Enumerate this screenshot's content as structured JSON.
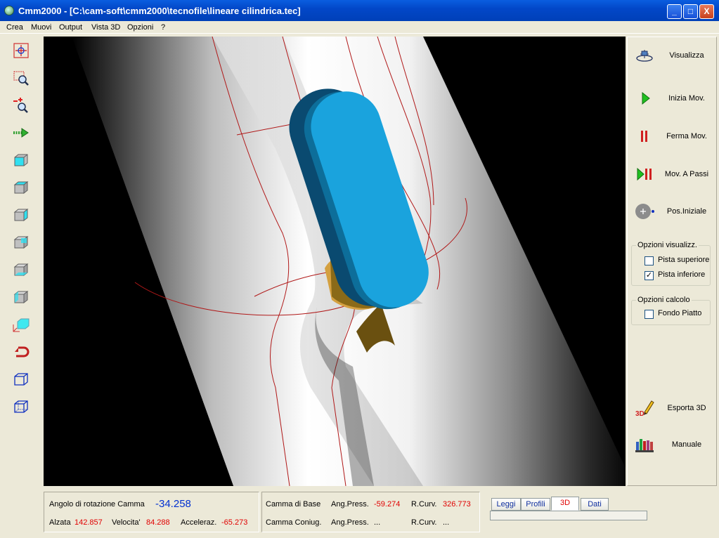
{
  "window": {
    "title": "Cmm2000 - [C:\\cam-soft\\cmm2000\\tecnofile\\lineare cilindrica.tec]",
    "min_label": "_",
    "max_label": "□",
    "close_label": "X"
  },
  "menu": [
    "Crea",
    "Muovi",
    "Output",
    "Vista 3D",
    "Opzioni",
    "?"
  ],
  "right_panel": {
    "visualizza": "Visualizza",
    "inizia": "Inizia Mov.",
    "ferma": "Ferma Mov.",
    "passi": "Mov. A Passi",
    "pos": "Pos.Iniziale",
    "opzioni_visualizz": {
      "title": "Opzioni visualizz.",
      "pista_superiore": "Pista superiore",
      "pista_inferiore": "Pista inferiore"
    },
    "opzioni_calcolo": {
      "title": "Opzioni calcolo",
      "fondo_piatto": "Fondo Piatto"
    },
    "esporta_icon_text": "3D",
    "esporta": "Esporta 3D",
    "manuale": "Manuale"
  },
  "status": {
    "angolo_label": "Angolo di rotazione Camma",
    "angolo_value": "-34.258",
    "alzata_label": "Alzata",
    "alzata_value": "142.857",
    "velocita_label": "Velocita'",
    "velocita_value": "84.288",
    "acceler_label": "Acceleraz.",
    "acceler_value": "-65.273"
  },
  "camma": {
    "base_label": "Camma di Base",
    "base_ang_label": "Ang.Press.",
    "base_ang_value": "-59.274",
    "base_rcurv_label": "R.Curv.",
    "base_rcurv_value": "326.773",
    "coniug_label": "Camma Coniug.",
    "coniug_ang_label": "Ang.Press.",
    "coniug_ang_value": "...",
    "coniug_rcurv_label": "R.Curv.",
    "coniug_rcurv_value": "..."
  },
  "tabs": [
    "Leggi",
    "Profili",
    "3D",
    "Dati"
  ]
}
